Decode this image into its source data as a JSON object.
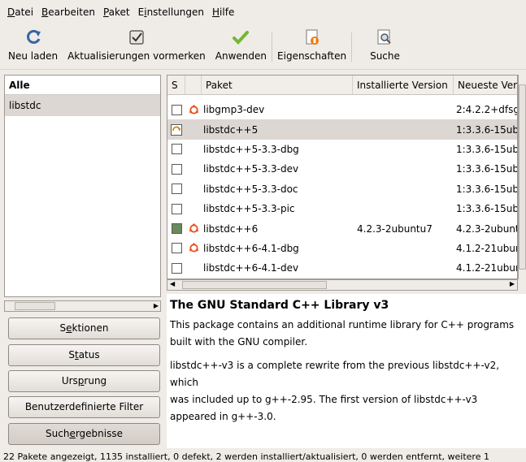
{
  "menu": [
    {
      "pre": "",
      "u": "D",
      "post": "atei"
    },
    {
      "pre": "",
      "u": "B",
      "post": "earbeiten"
    },
    {
      "pre": "",
      "u": "P",
      "post": "aket"
    },
    {
      "pre": "E",
      "u": "i",
      "post": "nstellungen"
    },
    {
      "pre": "",
      "u": "H",
      "post": "ilfe"
    }
  ],
  "toolbar": {
    "reload": "Neu laden",
    "mark_upgrades": "Aktualisierungen vormerken",
    "apply": "Anwenden",
    "properties": "Eigenschaften",
    "search": "Suche"
  },
  "left_panel": {
    "header": "Alle",
    "items": [
      "libstdc"
    ]
  },
  "side_buttons": [
    {
      "pre": "S",
      "u": "e",
      "post": "ktionen"
    },
    {
      "pre": "S",
      "u": "t",
      "post": "atus"
    },
    {
      "pre": "Urs",
      "u": "p",
      "post": "rung"
    },
    {
      "pre": "Benutzerdefinierte Filter",
      "u": "",
      "post": ""
    },
    {
      "pre": "Such",
      "u": "e",
      "post": "rgebnisse"
    }
  ],
  "table": {
    "headers": {
      "s": "S",
      "package": "Paket",
      "installed": "Installierte Version",
      "latest": "Neueste Ver"
    },
    "rows": [
      {
        "check": "empty",
        "ubuntu": true,
        "name": "libgmp3-dev",
        "installed": "",
        "latest": "2:4.2.2+dfsg"
      },
      {
        "check": "locked",
        "ubuntu": false,
        "name": "libstdc++5",
        "installed": "",
        "latest": "1:3.3.6-15ub"
      },
      {
        "check": "empty",
        "ubuntu": false,
        "name": "libstdc++5-3.3-dbg",
        "installed": "",
        "latest": "1:3.3.6-15ub"
      },
      {
        "check": "empty",
        "ubuntu": false,
        "name": "libstdc++5-3.3-dev",
        "installed": "",
        "latest": "1:3.3.6-15ub"
      },
      {
        "check": "empty",
        "ubuntu": false,
        "name": "libstdc++5-3.3-doc",
        "installed": "",
        "latest": "1:3.3.6-15ub"
      },
      {
        "check": "empty",
        "ubuntu": false,
        "name": "libstdc++5-3.3-pic",
        "installed": "",
        "latest": "1:3.3.6-15ub"
      },
      {
        "check": "installed",
        "ubuntu": true,
        "name": "libstdc++6",
        "installed": "4.2.3-2ubuntu7",
        "latest": "4.2.3-2ubunt"
      },
      {
        "check": "empty",
        "ubuntu": true,
        "name": "libstdc++6-4.1-dbg",
        "installed": "",
        "latest": "4.1.2-21ubur"
      },
      {
        "check": "empty",
        "ubuntu": false,
        "name": "libstdc++6-4.1-dev",
        "installed": "",
        "latest": "4.1.2-21ubur"
      }
    ],
    "selected_index": 1
  },
  "description": {
    "title": "The GNU Standard C++ Library v3",
    "paragraphs": [
      "This package contains an additional runtime library for C++ programs built with the GNU compiler.",
      "libstdc++-v3 is a complete rewrite from the previous libstdc++-v2, which",
      "was included up to g++-2.95. The first version of libstdc++-v3 appeared in g++-3.0."
    ]
  },
  "status_bar": "22 Pakete angezeigt, 1135 installiert, 0 defekt, 2 werden installiert/aktualisiert, 0 werden entfernt, weitere 1"
}
